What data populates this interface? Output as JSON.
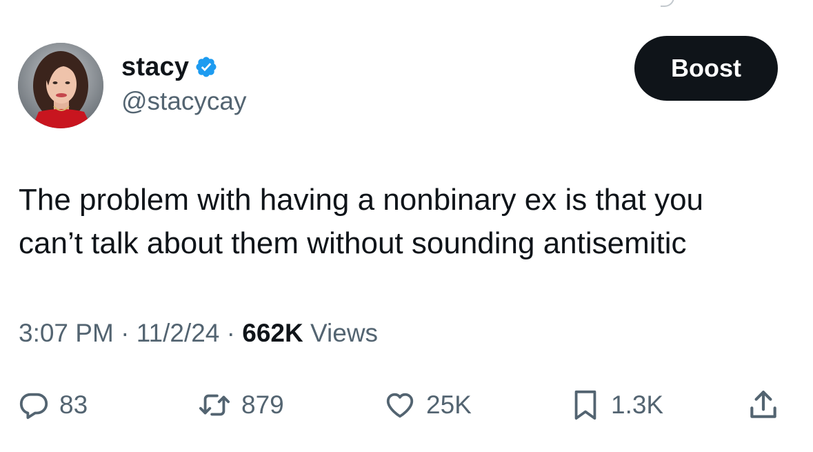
{
  "author": {
    "display_name": "stacy",
    "handle": "@stacycay",
    "verified_icon": "verified-badge-icon",
    "verified_color": "#1d9bf0"
  },
  "boost_button": {
    "label": "Boost"
  },
  "tweet": {
    "text": "The problem with having a nonbinary ex is that you\ncan’t talk about them without sounding antisemitic"
  },
  "meta": {
    "time": "3:07 PM",
    "separator": "·",
    "date": "11/2/24",
    "views_count": "662K",
    "views_label": "Views"
  },
  "actions": {
    "replies": {
      "icon": "reply-icon",
      "count": "83"
    },
    "reposts": {
      "icon": "repost-icon",
      "count": "879"
    },
    "likes": {
      "icon": "heart-icon",
      "count": "25K"
    },
    "bookmarks": {
      "icon": "bookmark-icon",
      "count": "1.3K"
    },
    "share": {
      "icon": "share-icon"
    }
  },
  "colors": {
    "text_primary": "#0f1419",
    "text_secondary": "#536471",
    "button_bg": "#0f1419",
    "button_text": "#ffffff"
  }
}
